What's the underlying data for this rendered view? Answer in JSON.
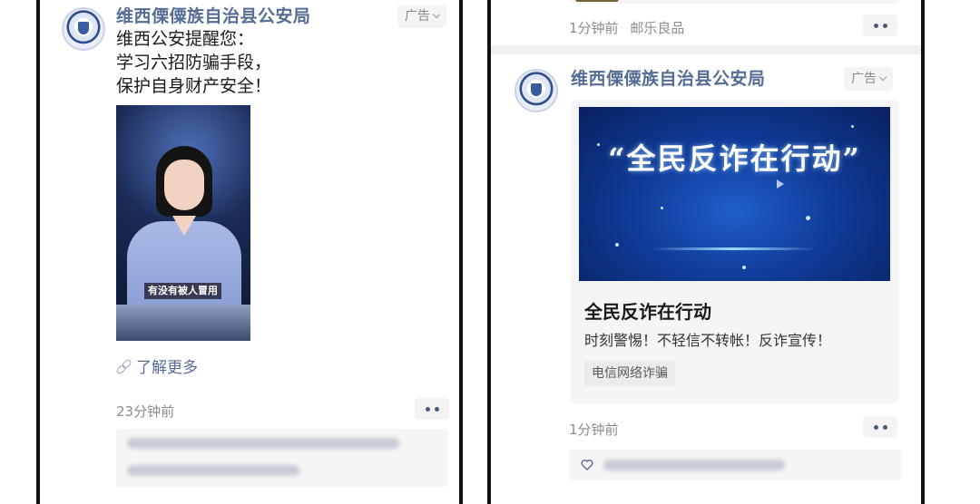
{
  "left_post": {
    "account_name": "维西傈僳族自治县公安局",
    "ad_tag": "广告",
    "text_lines": [
      "维西公安提醒您：",
      "学习六招防骗手段，",
      "保护自身财产安全！"
    ],
    "video_caption": "有没有被人冒用",
    "link_label": "了解更多",
    "time": "23分钟前"
  },
  "right_prev_post": {
    "time": "1分钟前",
    "source": "邮乐良品"
  },
  "right_post": {
    "account_name": "维西傈僳族自治县公安局",
    "ad_tag": "广告",
    "banner_title": "“全民反诈在行动”",
    "card_title": "全民反诈在行动",
    "card_desc": "时刻警惕！不轻信不转帐！反诈宣传！",
    "card_tag": "电信网络诈骗",
    "time": "1分钟前"
  },
  "icons": {
    "more": "more-dots-icon",
    "link": "link-icon",
    "like": "heart-icon",
    "ad_menu": "chevron-down-icon"
  },
  "colors": {
    "account_name": "#556c95",
    "link": "#576b95",
    "banner_blue": "#103c9a"
  }
}
